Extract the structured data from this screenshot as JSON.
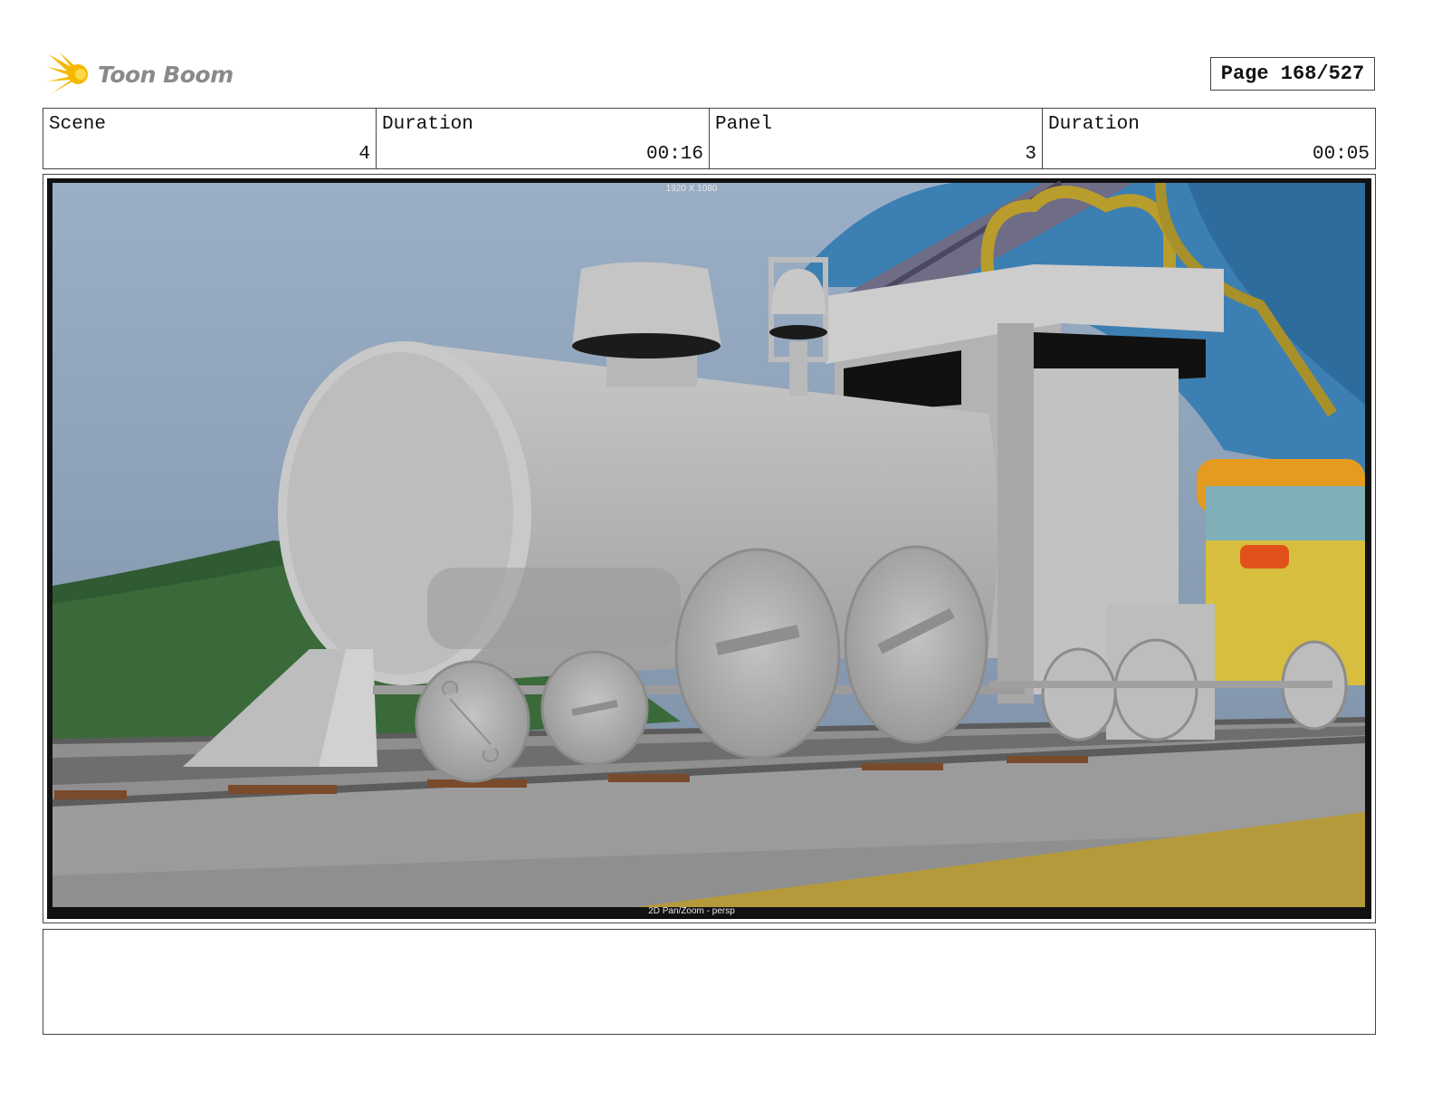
{
  "header": {
    "logo_text": "Toon Boom",
    "page_label": "Page 168/527"
  },
  "info": {
    "scene_label": "Scene",
    "scene_value": "4",
    "scene_duration_label": "Duration",
    "scene_duration_value": "00:16",
    "panel_label": "Panel",
    "panel_value": "3",
    "panel_duration_label": "Duration",
    "panel_duration_value": "00:05"
  },
  "panel": {
    "image_description_icon": "storyboard-panel-image",
    "top_overlay_text": "1920 X 1080",
    "bottom_overlay_text": "2D Pan/Zoom - persp"
  },
  "notes": {
    "text": ""
  },
  "colors": {
    "logo_yellow": "#f5b800",
    "border": "#444444"
  }
}
